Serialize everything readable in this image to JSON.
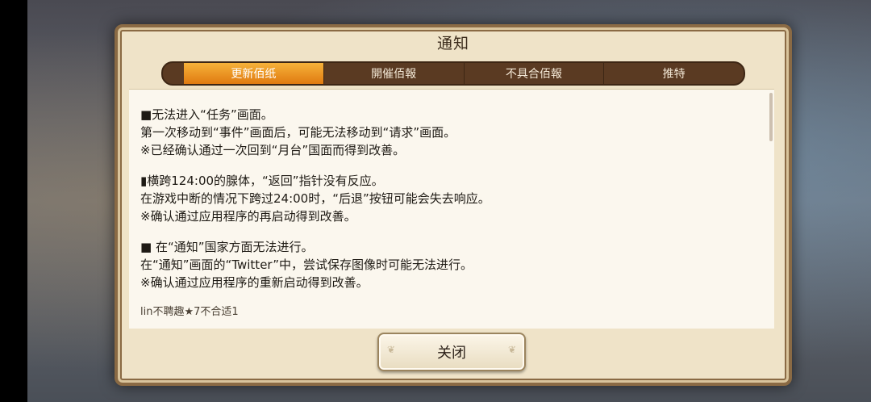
{
  "dialog": {
    "title": "通知",
    "tabs": [
      "更新佰纸",
      "開催佰報",
      "不具合佰報",
      "推特"
    ],
    "active_tab": "更新佰纸",
    "lines": [
      "■无法进入“任务”画面。",
      "第一次移动到“事件”画面后，可能无法移动到“请求”画面。",
      "※已经确认通过一次回到“月台”国面而得到改善。",
      "▮横跨124:00的腺体，“返回”指针没有反应。",
      "在游戏中断的情况下跨过24:00时，“后退”按钮可能会失去响应。",
      "※确认通过应用程序的再启动得到改善。",
      "■ 在“通知”国家方面无法进行。",
      "在“通知”画面的“Twitter”中，尝试保存图像时可能无法进行。",
      "※确认通过应用程序的重新启动得到改善。"
    ],
    "footer_note": "lin不聘趣★7不合适1",
    "close_label": "关闭"
  },
  "colors": {
    "tab_active": "#e07a10",
    "tab_bg": "#5a3a22",
    "panel_bg": "#efe3c8",
    "content_bg": "#fbf7ee"
  }
}
